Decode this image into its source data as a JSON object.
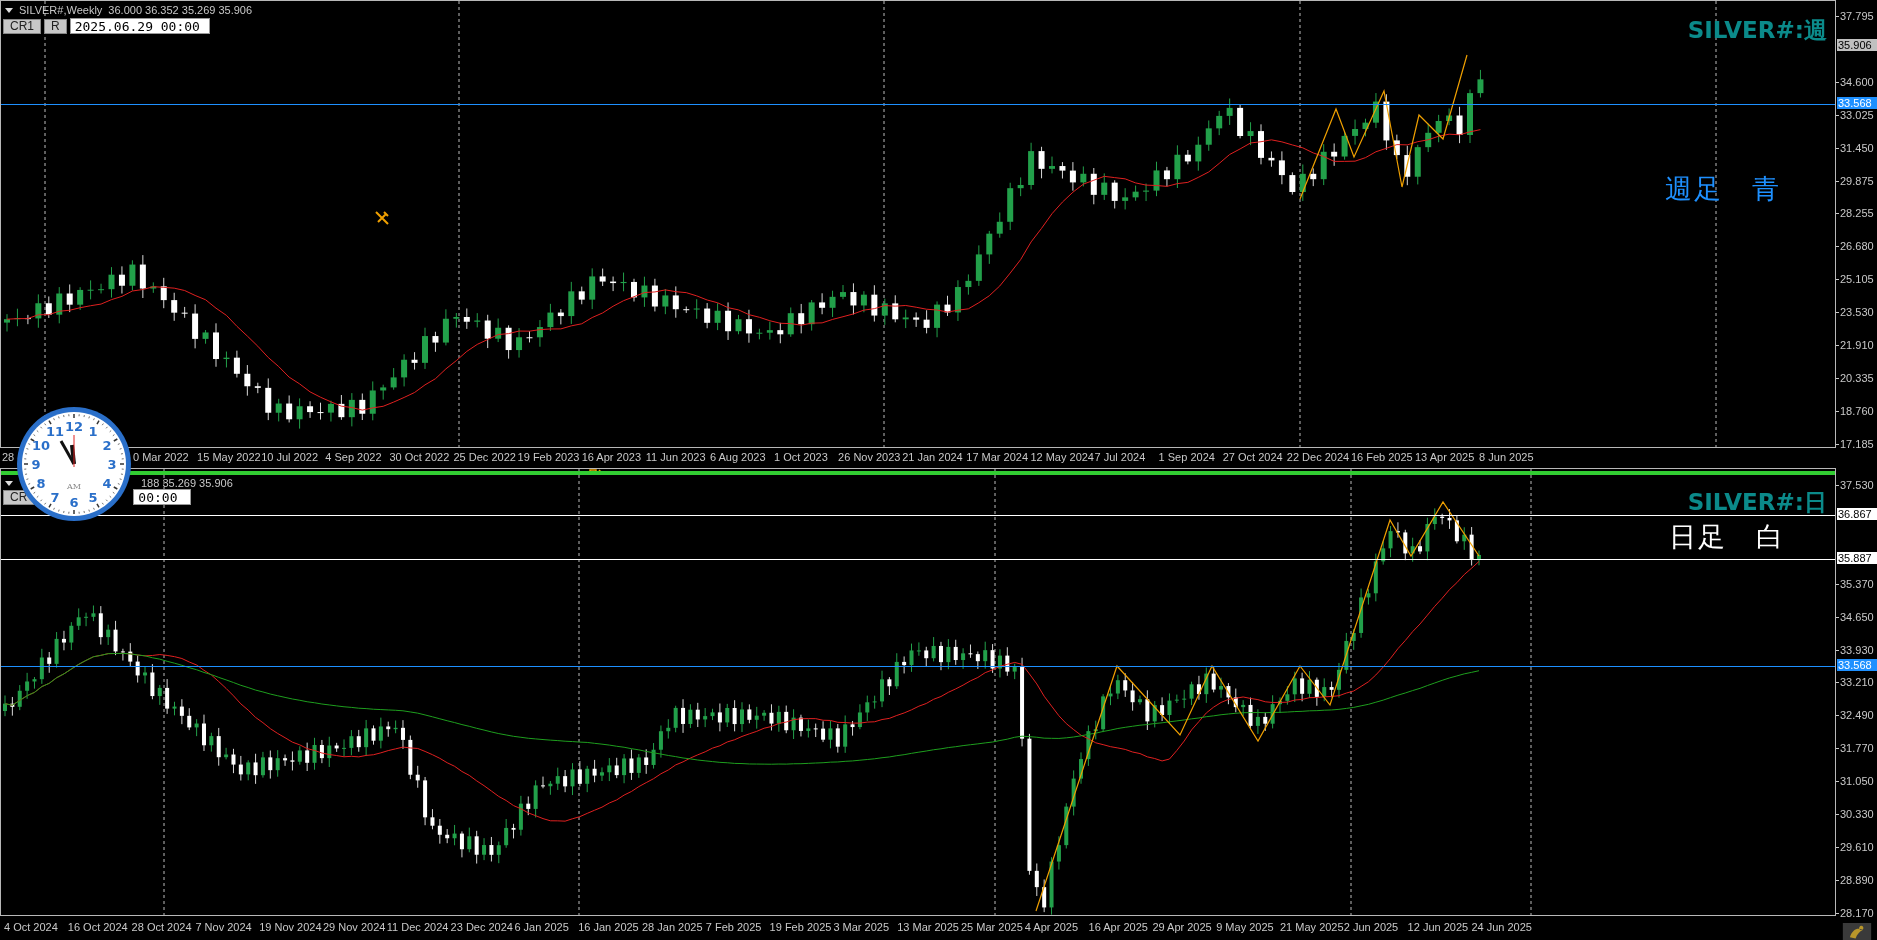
{
  "top_chart": {
    "header": {
      "symbol": "SILVER#,Weekly",
      "ohlc": "36.000 36.352 35.269 35.906"
    },
    "buttons": [
      "CR1",
      "R"
    ],
    "date_field": "2025.06.29 00:00",
    "symbol_label": "SILVER#:週",
    "note": {
      "text": "週足　青",
      "color": "#1e90ff"
    },
    "price_axis": [
      "37.795",
      "34.600",
      "33.025",
      "31.450",
      "29.875",
      "28.255",
      "26.680",
      "25.105",
      "23.530",
      "21.910",
      "20.335",
      "18.760",
      "17.185"
    ],
    "price_tags": [
      {
        "text": "35.906",
        "kind": "bid",
        "color": "#c0c0c0"
      },
      {
        "text": "33.568",
        "kind": "line",
        "color": "#1e90ff"
      }
    ],
    "time_axis": [
      "28",
      "0 Mar 2022",
      "15 May 2022",
      "10 Jul 2022",
      "4 Sep 2022",
      "30 Oct 2022",
      "25 Dec 2022",
      "19 Feb 2023",
      "16 Apr 2023",
      "11 Jun 2023",
      "6 Aug 2023",
      "1 Oct 2023",
      "26 Nov 2023",
      "21 Jan 2024",
      "17 Mar 2024",
      "12 May 2024",
      "7 Jul 2024",
      "1 Sep 2024",
      "27 Oct 2024",
      "22 Dec 2024",
      "16 Feb 2025",
      "13 Apr 2025",
      "8 Jun 2025"
    ]
  },
  "bottom_chart": {
    "header": {
      "ohlc": "188 35.269 35.906"
    },
    "buttons": [
      "CR"
    ],
    "date_field": "00:00",
    "symbol_label": "SILVER#:日",
    "note": {
      "text": "日足　白",
      "color": "#ffffff"
    },
    "price_axis": [
      "37.530",
      "35.370",
      "34.650",
      "33.930",
      "33.210",
      "32.490",
      "31.770",
      "31.050",
      "30.330",
      "29.610",
      "28.890",
      "28.170"
    ],
    "price_tags": [
      {
        "text": "36.867",
        "kind": "line",
        "color": "#ffffff"
      },
      {
        "text": "35.887",
        "kind": "line",
        "color": "#ffffff"
      },
      {
        "text": "33.568",
        "kind": "line",
        "color": "#1e90ff"
      }
    ],
    "time_axis": [
      "4 Oct 2024",
      "16 Oct 2024",
      "28 Oct 2024",
      "7 Nov 2024",
      "19 Nov 2024",
      "29 Nov 2024",
      "11 Dec 2024",
      "23 Dec 2024",
      "6 Jan 2025",
      "16 Jan 2025",
      "28 Jan 2025",
      "7 Feb 2025",
      "19 Feb 2025",
      "3 Mar 2025",
      "13 Mar 2025",
      "25 Mar 2025",
      "4 Apr 2025",
      "16 Apr 2025",
      "29 Apr 2025",
      "9 May 2025",
      "21 May 2025",
      "2 Jun 2025",
      "12 Jun 2025",
      "24 Jun 2025"
    ]
  },
  "clock": {
    "numerals": [
      "12",
      "11",
      "1",
      "10",
      "2",
      "9",
      "3",
      "8",
      "4",
      "7",
      "5",
      "6"
    ],
    "meridiem": "AM"
  }
}
